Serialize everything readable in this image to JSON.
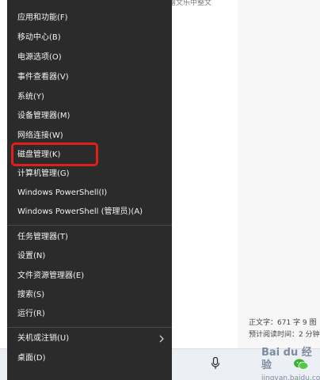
{
  "background": {
    "top_fragment": "赠文乐中整文",
    "stats": {
      "word_count": "正文字：671 字 9 图",
      "read_time": "预计阅读时间：2 分钟"
    },
    "watermark": {
      "main": "Bai du 经验",
      "sub": "jingyan.baidu.com"
    }
  },
  "menu": {
    "items": [
      {
        "id": "apps-features",
        "label": "应用和功能(F)"
      },
      {
        "id": "mobility-center",
        "label": "移动中心(B)"
      },
      {
        "id": "power-options",
        "label": "电源选项(O)"
      },
      {
        "id": "event-viewer",
        "label": "事件查看器(V)"
      },
      {
        "id": "system",
        "label": "系统(Y)"
      },
      {
        "id": "device-manager",
        "label": "设备管理器(M)"
      },
      {
        "id": "network-connections",
        "label": "网络连接(W)"
      },
      {
        "id": "disk-management",
        "label": "磁盘管理(K)"
      },
      {
        "id": "computer-management",
        "label": "计算机管理(G)"
      },
      {
        "id": "powershell",
        "label": "Windows PowerShell(I)"
      },
      {
        "id": "powershell-admin",
        "label": "Windows PowerShell (管理员)(A)"
      },
      {
        "id": "task-manager",
        "label": "任务管理器(T)"
      },
      {
        "id": "settings",
        "label": "设置(N)"
      },
      {
        "id": "file-explorer",
        "label": "文件资源管理器(E)"
      },
      {
        "id": "search",
        "label": "搜索(S)"
      },
      {
        "id": "run",
        "label": "运行(R)"
      },
      {
        "id": "shutdown",
        "label": "关机或注销(U)"
      },
      {
        "id": "desktop",
        "label": "桌面(D)"
      }
    ],
    "highlighted": "disk-management",
    "colors": {
      "menu_bg": "#2b2b2b",
      "menu_text": "#f2f2f2",
      "highlight": "#e01e1e"
    }
  }
}
